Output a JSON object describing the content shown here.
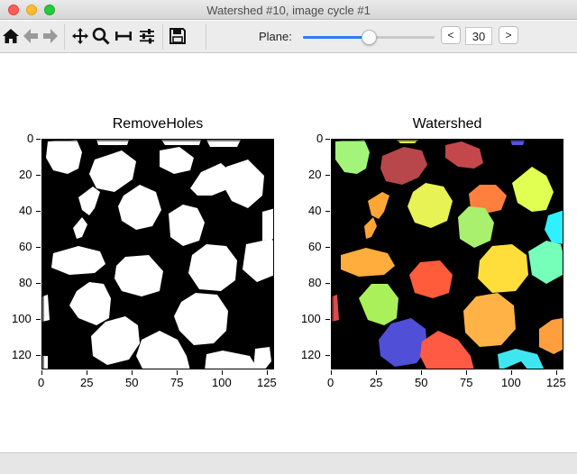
{
  "window": {
    "title": "Watershed #10, image cycle #1"
  },
  "toolbar": {
    "icons": [
      "home-icon",
      "back-icon",
      "forward-icon",
      "pan-icon",
      "zoom-icon",
      "subplots-icon",
      "configure-icon",
      "save-icon"
    ],
    "plane_label": "Plane:",
    "plane_value": "30",
    "plane_fraction": 0.5,
    "prev_label": "<",
    "next_label": ">"
  },
  "figure": {
    "left_title": "RemoveHoles",
    "right_title": "Watershed",
    "y_ticks": [
      "0",
      "20",
      "40",
      "60",
      "80",
      "100",
      "120"
    ],
    "x_ticks": [
      "0",
      "25",
      "50",
      "75",
      "100",
      "125"
    ],
    "image_size": [
      128,
      128
    ]
  },
  "colors": {
    "accent": "#2f7cf6",
    "label_palette": [
      "#a3f57a",
      "#b7474a",
      "#c4474b",
      "#e7f255",
      "#ff7f3f",
      "#e0ff52",
      "#ffa636",
      "#a8f06e",
      "#2ef0ff",
      "#ffad3d",
      "#ff5c3c",
      "#ffde3c",
      "#75ffb8",
      "#a9f05a",
      "#ffb347",
      "#ff9e3d",
      "#4f4fd8",
      "#ff5a44",
      "#3fe6f0",
      "#d94d4d",
      "#5555e0"
    ]
  }
}
